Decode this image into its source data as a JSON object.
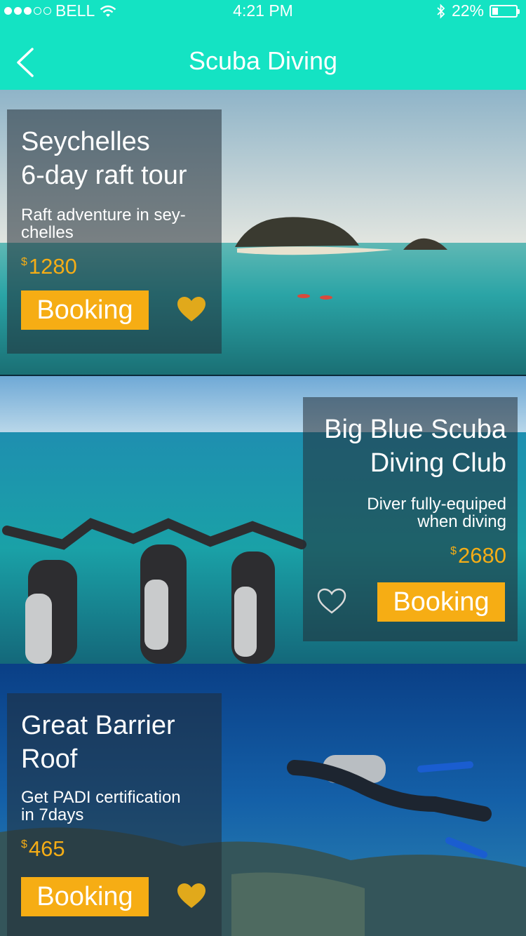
{
  "status_bar": {
    "carrier": "BELL",
    "signal_dots_filled": 3,
    "signal_dots_total": 5,
    "time": "4:21 PM",
    "battery": "22%",
    "battery_level": 0.22
  },
  "nav": {
    "title": "Scuba Diving",
    "back_icon": "chevron-left-icon"
  },
  "colors": {
    "header": "#14e3c3",
    "accent": "#f6ad14",
    "price": "#f5ad16"
  },
  "tours": [
    {
      "title": "Seychelles\n6-day raft tour",
      "subtitle": "Raft adventure in sey-\nchelles",
      "currency": "$",
      "price": "1280",
      "button": "Booking",
      "favorite_icon": "heart-icon",
      "favorited": true
    },
    {
      "title": "Big Blue Scuba\nDiving Club",
      "subtitle": "Diver fully-equiped\nwhen diving",
      "currency": "$",
      "price": "2680",
      "button": "Booking",
      "favorite_icon": "heart-outline-icon",
      "favorited": false
    },
    {
      "title": "Great Barrier\nRoof",
      "subtitle": "Get PADI certification\nin 7days",
      "currency": "$",
      "price": "465",
      "button": "Booking",
      "favorite_icon": "heart-icon",
      "favorited": true
    }
  ]
}
